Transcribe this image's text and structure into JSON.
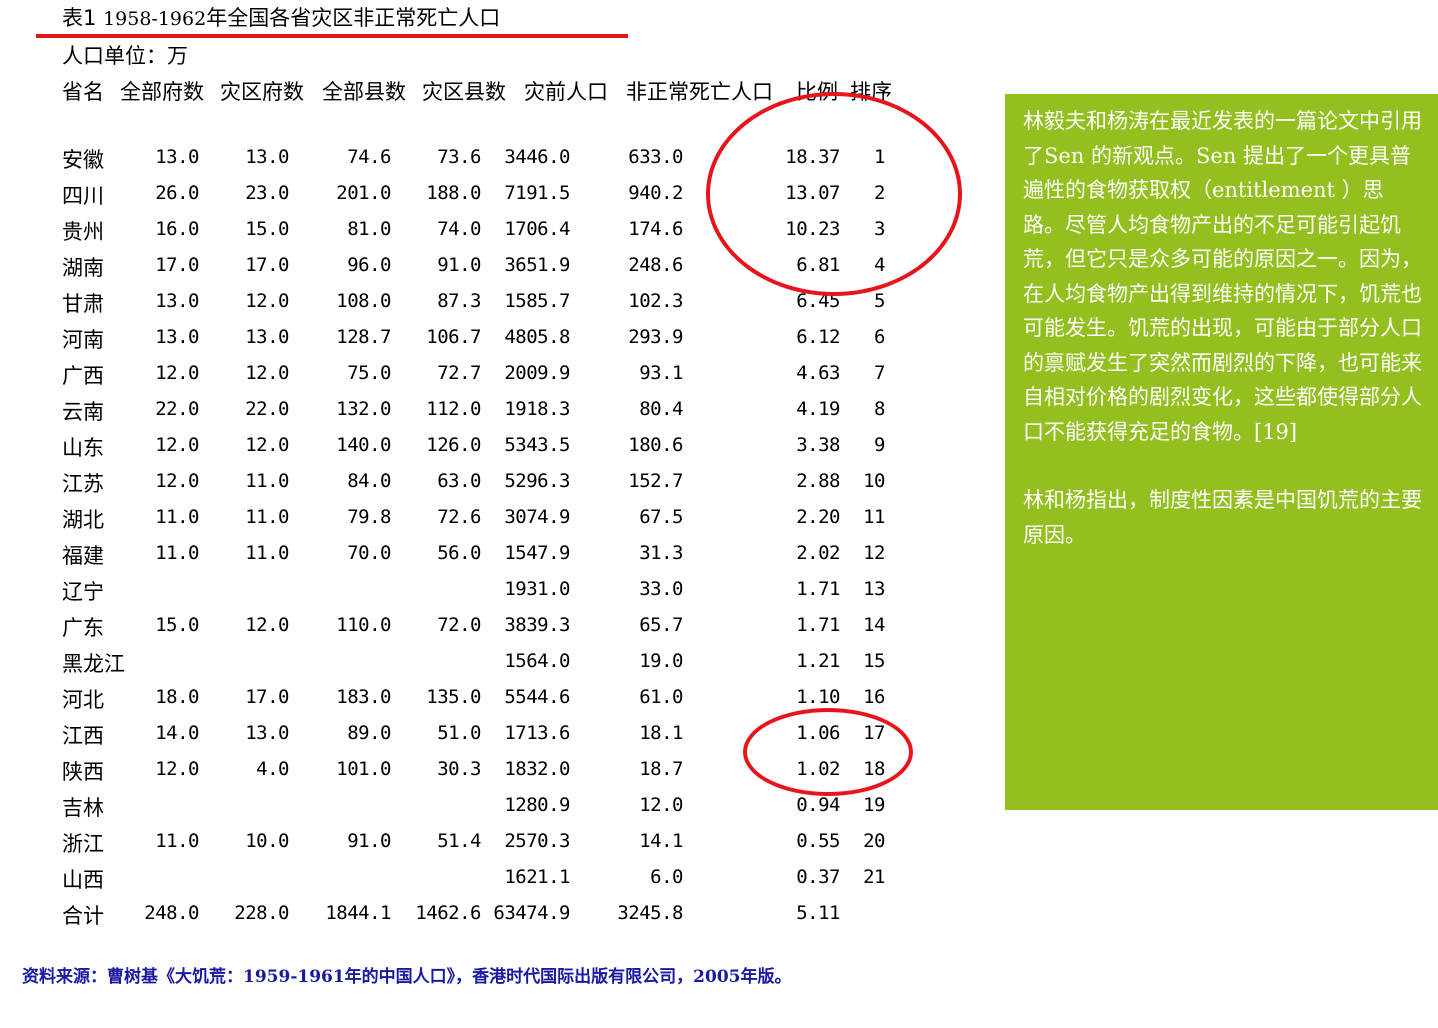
{
  "title": {
    "label": "表1",
    "years": "1958-1962",
    "text": "年全国各省灾区非正常死亡人口"
  },
  "unit": "人口单位：万",
  "headers": [
    "省名",
    "全部府数",
    "灾区府数",
    "全部县数",
    "灾区县数",
    "灾前人口",
    "非正常死亡人口",
    "比例",
    "排序"
  ],
  "rows": [
    {
      "name": "安徽",
      "c1": "13.0",
      "c2": "13.0",
      "c3": "74.6",
      "c4": "73.6",
      "c5": "3446.0",
      "c6": "633.0",
      "c7": "18.37",
      "c8": "1"
    },
    {
      "name": "四川",
      "c1": "26.0",
      "c2": "23.0",
      "c3": "201.0",
      "c4": "188.0",
      "c5": "7191.5",
      "c6": "940.2",
      "c7": "13.07",
      "c8": "2"
    },
    {
      "name": "贵州",
      "c1": "16.0",
      "c2": "15.0",
      "c3": "81.0",
      "c4": "74.0",
      "c5": "1706.4",
      "c6": "174.6",
      "c7": "10.23",
      "c8": "3"
    },
    {
      "name": "湖南",
      "c1": "17.0",
      "c2": "17.0",
      "c3": "96.0",
      "c4": "91.0",
      "c5": "3651.9",
      "c6": "248.6",
      "c7": "6.81",
      "c8": "4"
    },
    {
      "name": "甘肃",
      "c1": "13.0",
      "c2": "12.0",
      "c3": "108.0",
      "c4": "87.3",
      "c5": "1585.7",
      "c6": "102.3",
      "c7": "6.45",
      "c8": "5"
    },
    {
      "name": "河南",
      "c1": "13.0",
      "c2": "13.0",
      "c3": "128.7",
      "c4": "106.7",
      "c5": "4805.8",
      "c6": "293.9",
      "c7": "6.12",
      "c8": "6"
    },
    {
      "name": "广西",
      "c1": "12.0",
      "c2": "12.0",
      "c3": "75.0",
      "c4": "72.7",
      "c5": "2009.9",
      "c6": "93.1",
      "c7": "4.63",
      "c8": "7"
    },
    {
      "name": "云南",
      "c1": "22.0",
      "c2": "22.0",
      "c3": "132.0",
      "c4": "112.0",
      "c5": "1918.3",
      "c6": "80.4",
      "c7": "4.19",
      "c8": "8"
    },
    {
      "name": "山东",
      "c1": "12.0",
      "c2": "12.0",
      "c3": "140.0",
      "c4": "126.0",
      "c5": "5343.5",
      "c6": "180.6",
      "c7": "3.38",
      "c8": "9"
    },
    {
      "name": "江苏",
      "c1": "12.0",
      "c2": "11.0",
      "c3": "84.0",
      "c4": "63.0",
      "c5": "5296.3",
      "c6": "152.7",
      "c7": "2.88",
      "c8": "10"
    },
    {
      "name": "湖北",
      "c1": "11.0",
      "c2": "11.0",
      "c3": "79.8",
      "c4": "72.6",
      "c5": "3074.9",
      "c6": "67.5",
      "c7": "2.20",
      "c8": "11"
    },
    {
      "name": "福建",
      "c1": "11.0",
      "c2": "11.0",
      "c3": "70.0",
      "c4": "56.0",
      "c5": "1547.9",
      "c6": "31.3",
      "c7": "2.02",
      "c8": "12"
    },
    {
      "name": "辽宁",
      "c1": "",
      "c2": "",
      "c3": "",
      "c4": "",
      "c5": "1931.0",
      "c6": "33.0",
      "c7": "1.71",
      "c8": "13"
    },
    {
      "name": "广东",
      "c1": "15.0",
      "c2": "12.0",
      "c3": "110.0",
      "c4": "72.0",
      "c5": "3839.3",
      "c6": "65.7",
      "c7": "1.71",
      "c8": "14"
    },
    {
      "name": "黑龙江",
      "c1": "",
      "c2": "",
      "c3": "",
      "c4": "",
      "c5": "1564.0",
      "c6": "19.0",
      "c7": "1.21",
      "c8": "15"
    },
    {
      "name": "河北",
      "c1": "18.0",
      "c2": "17.0",
      "c3": "183.0",
      "c4": "135.0",
      "c5": "5544.6",
      "c6": "61.0",
      "c7": "1.10",
      "c8": "16"
    },
    {
      "name": "江西",
      "c1": "14.0",
      "c2": "13.0",
      "c3": "89.0",
      "c4": "51.0",
      "c5": "1713.6",
      "c6": "18.1",
      "c7": "1.06",
      "c8": "17"
    },
    {
      "name": "陕西",
      "c1": "12.0",
      "c2": "4.0",
      "c3": "101.0",
      "c4": "30.3",
      "c5": "1832.0",
      "c6": "18.7",
      "c7": "1.02",
      "c8": "18"
    },
    {
      "name": "吉林",
      "c1": "",
      "c2": "",
      "c3": "",
      "c4": "",
      "c5": "1280.9",
      "c6": "12.0",
      "c7": "0.94",
      "c8": "19"
    },
    {
      "name": "浙江",
      "c1": "11.0",
      "c2": "10.0",
      "c3": "91.0",
      "c4": "51.4",
      "c5": "2570.3",
      "c6": "14.1",
      "c7": "0.55",
      "c8": "20"
    },
    {
      "name": "山西",
      "c1": "",
      "c2": "",
      "c3": "",
      "c4": "",
      "c5": "1621.1",
      "c6": "6.0",
      "c7": "0.37",
      "c8": "21"
    }
  ],
  "total": {
    "name": "合计",
    "c1": "248.0",
    "c2": "228.0",
    "c3": "1844.1",
    "c4": "1462.6",
    "c5": "63474.9",
    "c6": "3245.8",
    "c7": "5.11",
    "c8": ""
  },
  "sidebox": {
    "para1": "林毅夫和杨涛在最近发表的一篇论文中引用了Sen 的新观点。Sen 提出了一个更具普遍性的食物获取权（entitlement ）思路。尽管人均食物产出的不足可能引起饥荒，但它只是众多可能的原因之一。因为，在人均食物产出得到维持的情况下，饥荒也可能发生。饥荒的出现，可能由于部分人口的禀赋发生了突然而剧烈的下降，也可能来自相对价格的剧烈变化，这些都使得部分人口不能获得充足的食物。[19]",
    "para2": "林和杨指出，制度性因素是中国饥荒的主要原因。"
  },
  "source": "资料来源：曹树基《大饥荒：1959-1961年的中国人口》，香港时代国际出版有限公司，2005年版。",
  "colors": {
    "annotation_red": "#e8141b",
    "sidebox_green": "#93c01f",
    "source_blue": "#1a1aa0"
  }
}
